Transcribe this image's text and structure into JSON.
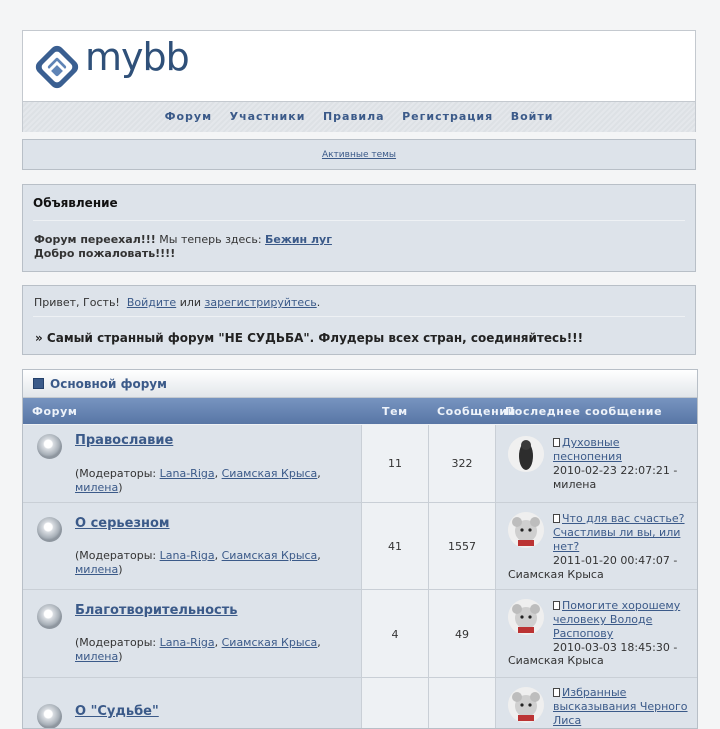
{
  "header": {
    "logo_text": "mybb",
    "nav": [
      "Форум",
      "Участники",
      "Правила",
      "Регистрация",
      "Войти"
    ]
  },
  "active_topics": "Активные темы",
  "announcement": {
    "title": "Объявление",
    "line1_bold": "Форум переехал!!!",
    "line1_text": " Мы теперь здесь: ",
    "line1_link": "Бежин луг",
    "line2": "Добро пожаловать!!!!"
  },
  "welcome": {
    "greeting": "Привет, Гость!  ",
    "login": "Войдите",
    "or": " или ",
    "register": "зарегистрируйтесь",
    "dot": ".",
    "motto": "» Самый странный форум \"НЕ СУДЬБА\". Флудеры всех стран, соединяйтесь!!!"
  },
  "category": {
    "title": "Основной форум",
    "columns": [
      "Форум",
      "Тем",
      "Сообщений",
      "Последнее сообщение"
    ]
  },
  "forums": [
    {
      "name": "Православие",
      "mods_prefix": "(Модераторы: ",
      "mod1": "Lana-Riga",
      "mod2": "Сиамская Крыса",
      "mod3": "милена",
      "topics": "11",
      "posts": "322",
      "last_title": "Духовные песнопения",
      "last_date": "2010-02-23 22:07:21 -",
      "last_user": "милена"
    },
    {
      "name": "О серьезном",
      "mods_prefix": "(Модераторы: ",
      "mod1": "Lana-Riga",
      "mod2": "Сиамская Крыса",
      "mod3": "милена",
      "topics": "41",
      "posts": "1557",
      "last_title": "Что для вас счастье? Счастливы ли вы, или нет?",
      "last_date": "2011-01-20 00:47:07 -",
      "last_user": "Сиамская Крыса"
    },
    {
      "name": "Благотворительность",
      "mods_prefix": "(Модераторы: ",
      "mod1": "Lana-Riga",
      "mod2": "Сиамская Крыса",
      "mod3": "милена",
      "topics": "4",
      "posts": "49",
      "last_title": "Помогите хорошему человеку Володе Распопову",
      "last_date": "2010-03-03 18:45:30 -",
      "last_user": "Сиамская Крыса"
    },
    {
      "name": "О \"Судьбе\"",
      "last_title": "Избранные высказывания Черного Лиса"
    }
  ]
}
